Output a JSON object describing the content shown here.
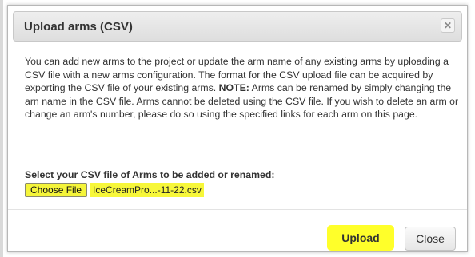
{
  "dialog": {
    "title": "Upload arms (CSV)",
    "close_icon": "close-icon",
    "description_part1": "You can add new arms to the project or update the arm name of any existing arms by uploading a CSV file with a new arms configuration. The format for the CSV upload file can be acquired by exporting the CSV file of your existing arms. ",
    "note_label": "NOTE:",
    "description_part2": " Arms can be renamed by simply changing the arn name in the CSV file. Arms cannot be deleted using the CSV file. If you wish to delete an arm or change an arm's number, please do so using the specified links for each arm on this page.",
    "select_label": "Select your CSV file of Arms to be added or renamed:",
    "choose_file_label": "Choose File",
    "selected_file_name": "IceCreamPro...-11-22.csv",
    "upload_label": "Upload",
    "close_label": "Close"
  },
  "colors": {
    "highlight": "#ffff2a",
    "title_bar": "#e6e6e6",
    "text": "#333333"
  }
}
